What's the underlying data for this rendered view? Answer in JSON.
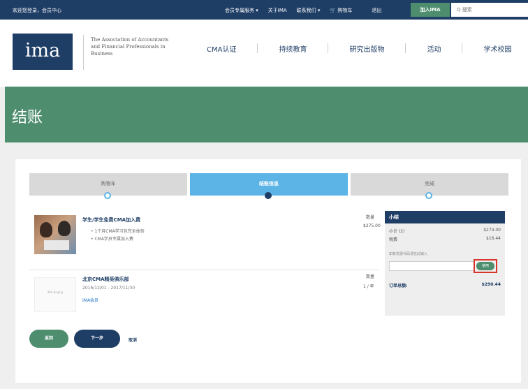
{
  "topbar": {
    "welcome": "欢迎您登录，会员中心",
    "links": [
      "会员专属服务 ▾",
      "关于IMA",
      "联系我们 ▾",
      "购物车",
      "退出"
    ],
    "join": "加入IMA",
    "search_placeholder": "Q 搜索"
  },
  "header": {
    "logo": "ima",
    "tagline": "The Association of Accountants and Financial Professionals in Business",
    "nav": [
      "CMA认证",
      "持续教育",
      "研究出版物",
      "活动",
      "学术校园"
    ]
  },
  "page_title": "结账",
  "steps": {
    "step1": "购物车",
    "step2": "结账信息",
    "step3": "完成"
  },
  "items": [
    {
      "title": "学生/学生免费CMA加入费",
      "bullets": [
        "1个月CMA学习包完全体验",
        "CMA学员专属加入费"
      ],
      "qty_label": "数量",
      "price": "$275.00"
    },
    {
      "title": "北京CMA精英俱乐部",
      "dates": "2016/12/01 - 2017/11/30",
      "link": "IMA会员",
      "qty_label": "数量",
      "qty_value": "1 / 年",
      "thumb_text": "IMA Beijing"
    }
  ],
  "summary": {
    "title": "小结",
    "subtotal_label": "小计 (2)",
    "subtotal": "$274.00",
    "tax_label": "税费",
    "tax": "$16.44",
    "promo_label": "如有优惠代码请在此输入",
    "apply": "使用",
    "total_label": "订单总额:",
    "total": "$290.44"
  },
  "buttons": {
    "back": "返回",
    "next": "下一步",
    "cancel": "取消"
  },
  "colors": {
    "navy": "#1f3e66",
    "green": "#4e8e6f",
    "step_active": "#5bb4e5",
    "highlight": "#d9342b"
  }
}
